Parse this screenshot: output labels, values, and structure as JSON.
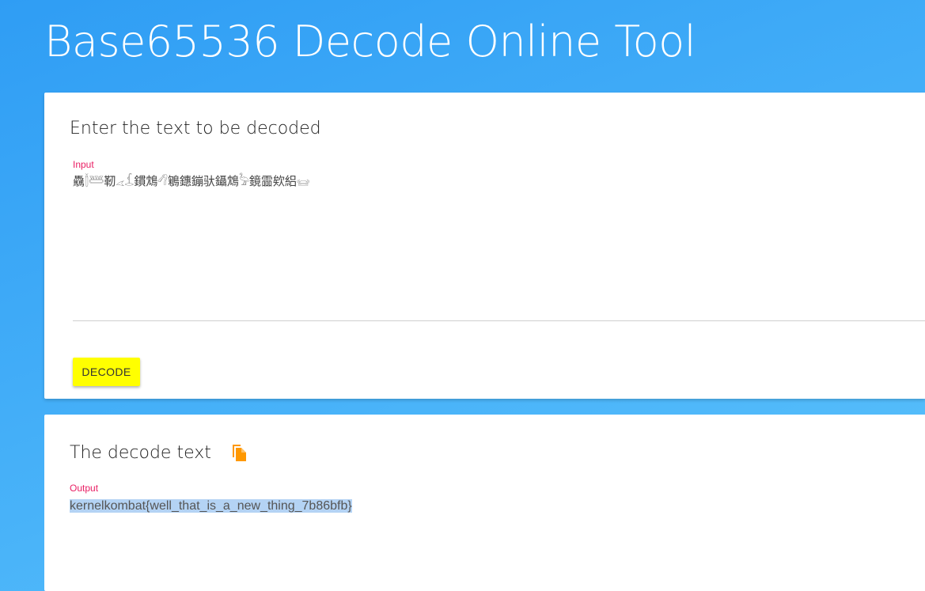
{
  "page": {
    "title": "Base65536 Decode Online Tool"
  },
  "input_card": {
    "heading": "Enter the text to be decoded",
    "field_label": "Input",
    "field_value": "驫𓆬𓆷靭𓂁𓆵鏆鴆𓆁鵴鏸鏰驮鑷鴆𓅦鏡霝欸絽𓊠",
    "decode_button_label": "DECODE"
  },
  "output_card": {
    "heading": "The decode text",
    "field_label": "Output",
    "field_value": "kernelkombat{well_that_is_a_new_thing_7b86bfb}"
  },
  "colors": {
    "background_start": "#2f9df4",
    "background_end": "#5cc3fc",
    "button": "#ffff00",
    "label_accent": "#e91e63",
    "copy_icon": "#ff9800",
    "selection": "#b4d3f4"
  },
  "icons": {
    "copy": "copy-icon"
  }
}
